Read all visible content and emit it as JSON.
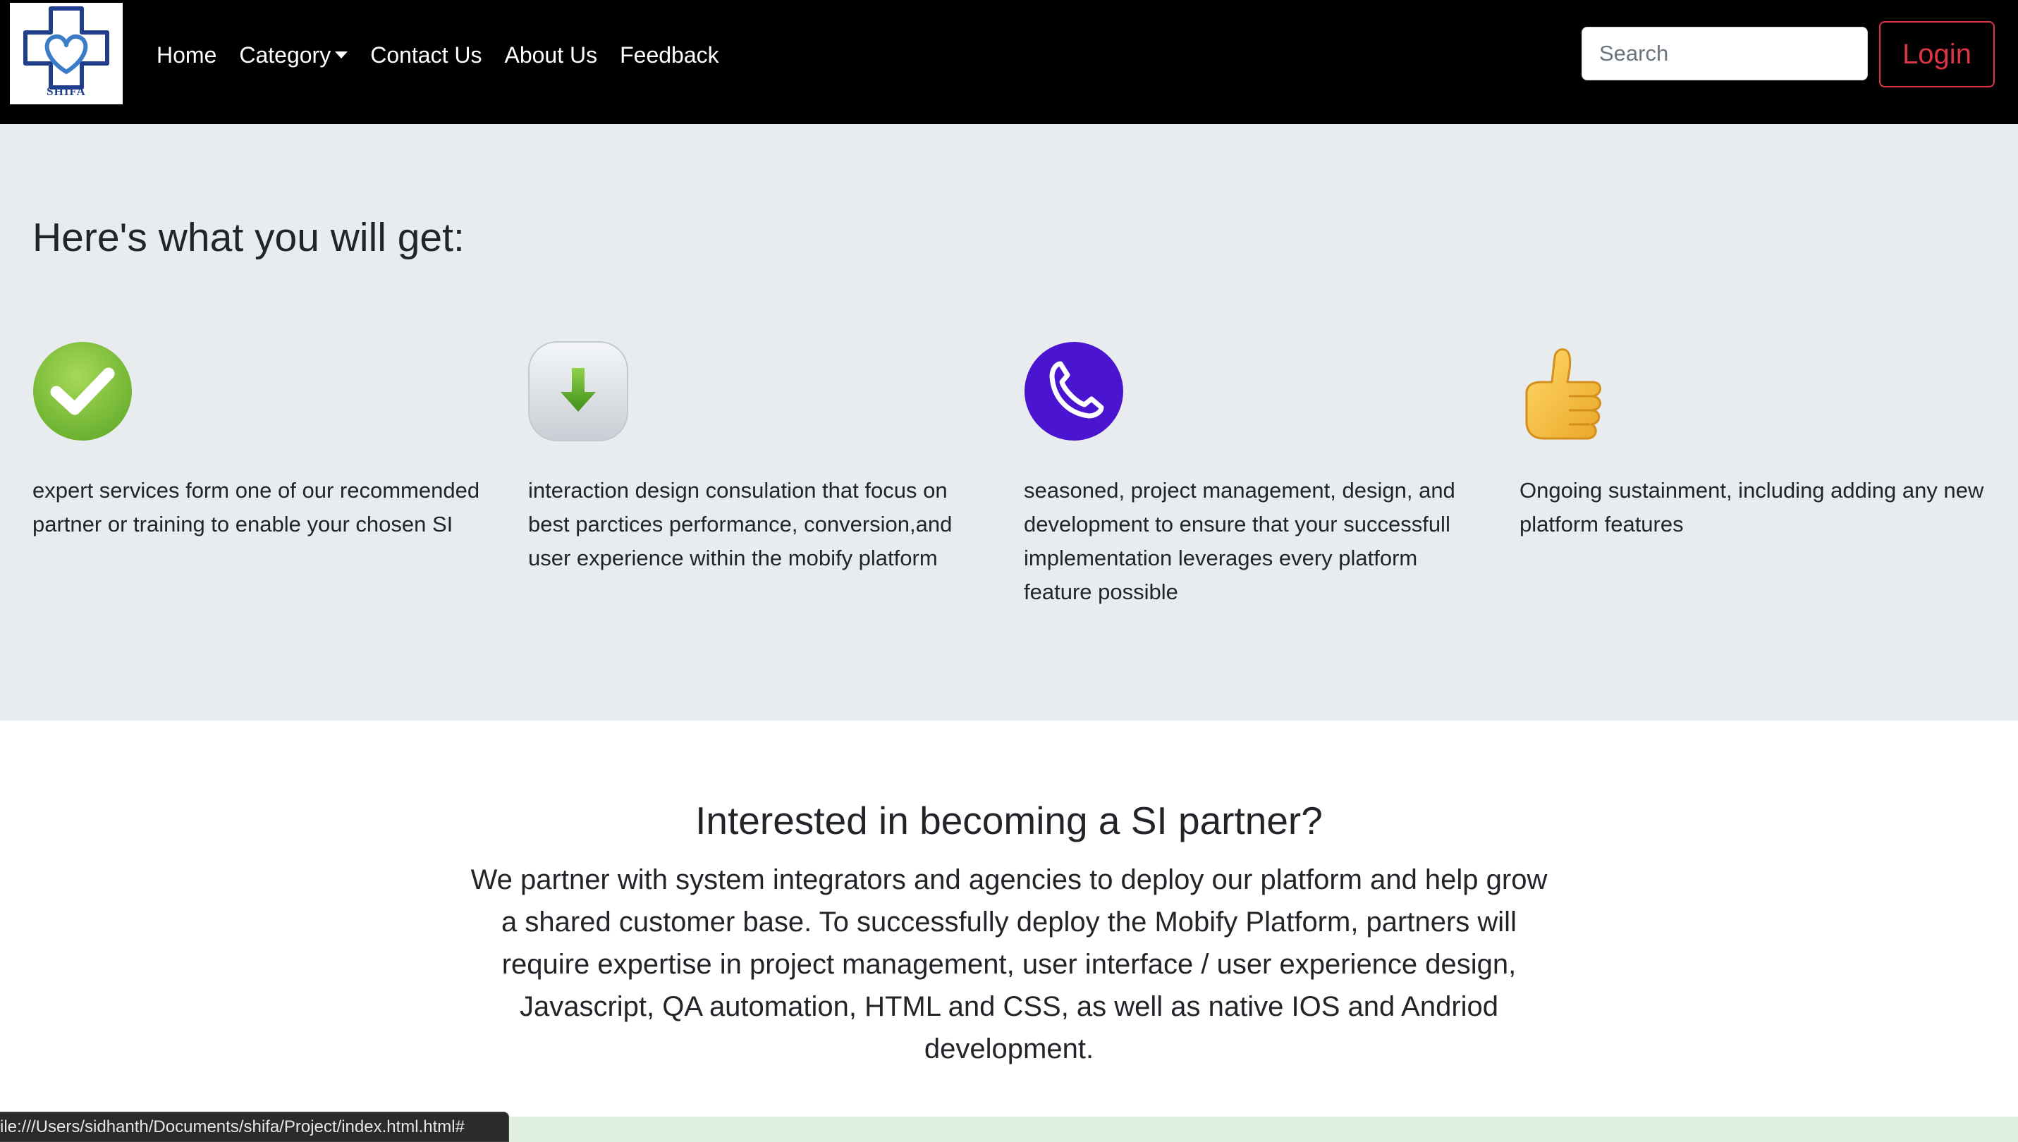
{
  "brand": {
    "logo_text": "SHIFA",
    "logo_color": "#1f3f8c"
  },
  "nav": {
    "items": [
      {
        "label": "Home"
      },
      {
        "label": "Category",
        "has_dropdown": true
      },
      {
        "label": "Contact Us"
      },
      {
        "label": "About Us"
      },
      {
        "label": "Feedback"
      }
    ]
  },
  "search": {
    "placeholder": "Search",
    "value": ""
  },
  "login": {
    "label": "Login",
    "color": "#dc3545"
  },
  "features": {
    "title": "Here's what you will get:",
    "items": [
      {
        "icon": "check-circle-icon",
        "color": "#7ec23d",
        "text": "expert services form one of our recommended partner or training to enable your chosen SI"
      },
      {
        "icon": "download-arrow-icon",
        "color": "#d9dee3",
        "text": "interaction design consulation that focus on best parctices performance, conversion,and user experience within the mobify platform"
      },
      {
        "icon": "phone-icon",
        "color": "#4b14d0",
        "text": "seasoned, project management, design, and development to ensure that your successfull implementation leverages every platform feature possible"
      },
      {
        "icon": "thumbs-up-icon",
        "color": "#f6c24a",
        "text": "Ongoing sustainment, including adding any new platform features"
      }
    ]
  },
  "partner": {
    "title": "Interested in becoming a SI partner?",
    "text": "We partner with system integrators and agencies to deploy our platform and help grow a shared customer base. To successfully deploy the Mobify Platform, partners will require expertise in project management, user interface / user experience design, Javascript, QA automation, HTML and CSS, as well as native IOS and Andriod development."
  },
  "status_bar": {
    "url": "ile:///Users/sidhanth/Documents/shifa/Project/index.html.html#"
  }
}
